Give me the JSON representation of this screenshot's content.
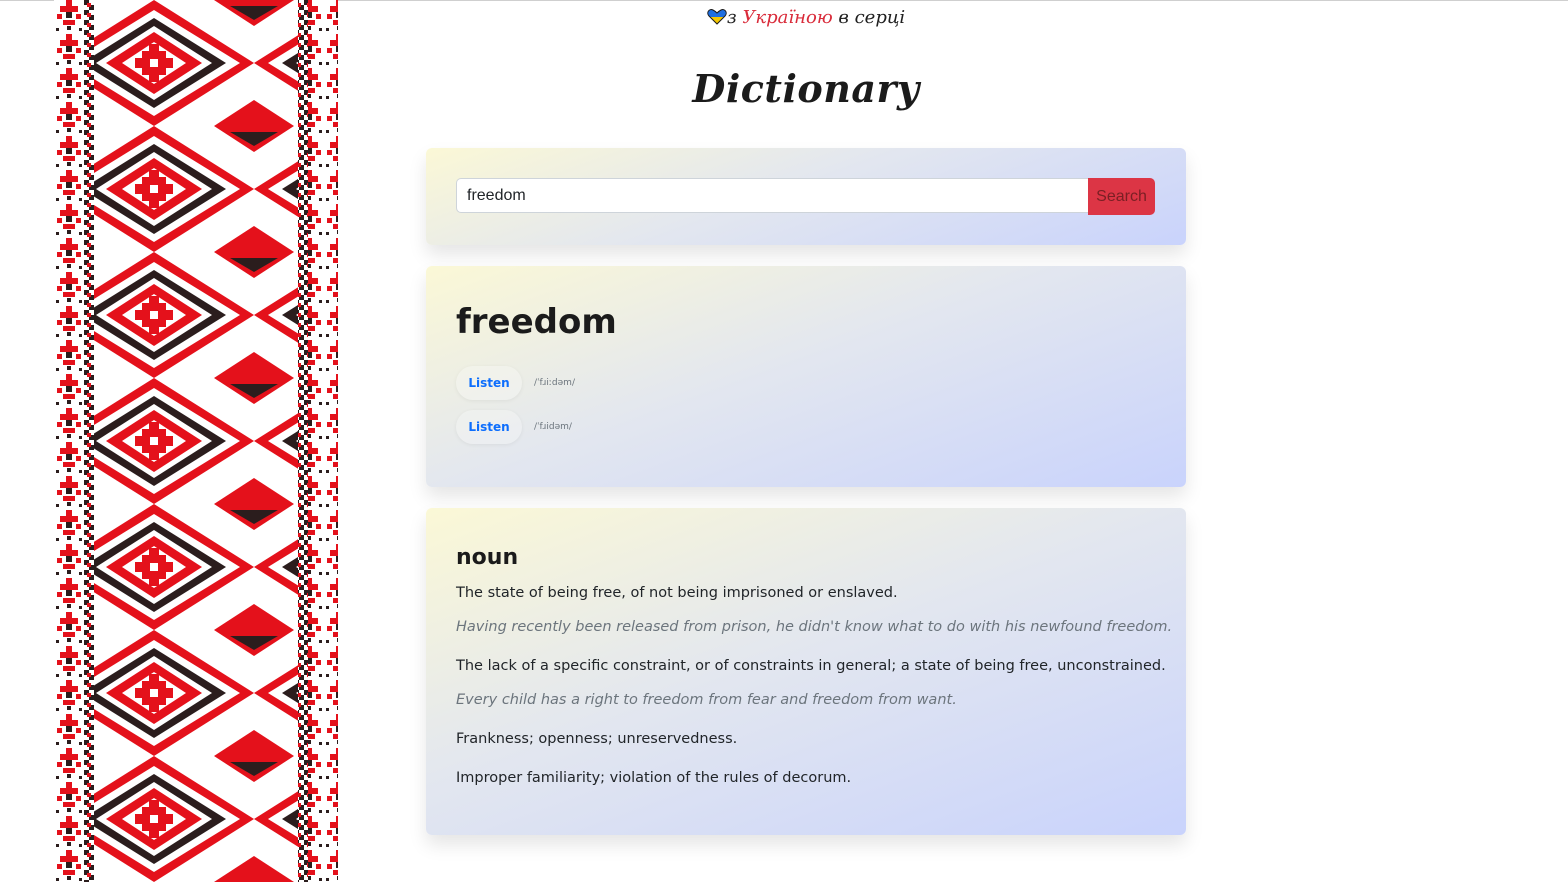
{
  "banner": {
    "prefix": "з ",
    "country": "Україною",
    "suffix": " в серці"
  },
  "app": {
    "title": "Dictionary"
  },
  "search": {
    "value": "freedom",
    "button_label": "Search"
  },
  "word": {
    "text": "freedom",
    "phonetics": [
      {
        "button_label": "Listen",
        "text": "/ˈfɹiːdəm/"
      },
      {
        "button_label": "Listen",
        "text": "/ˈfɹidəm/"
      }
    ]
  },
  "meaning": {
    "part_of_speech": "noun",
    "definitions": [
      {
        "text": "The state of being free, of not being imprisoned or enslaved.",
        "example": "Having recently been released from prison, he didn't know what to do with his newfound freedom."
      },
      {
        "text": "The lack of a specific constraint, or of constraints in general; a state of being free, unconstrained.",
        "example": "Every child has a right to freedom from fear and freedom from want."
      },
      {
        "text": "Frankness; openness; unreservedness."
      },
      {
        "text": "Improper familiarity; violation of the rules of decorum."
      }
    ]
  },
  "colors": {
    "accent": "#dc3545",
    "link": "#0d6efd",
    "ornament_red": "#e4111b",
    "ornament_dark": "#2b1d1d"
  },
  "icons": {
    "heart": "ukraine-heart-icon",
    "ornament": "embroidery-ornament"
  }
}
